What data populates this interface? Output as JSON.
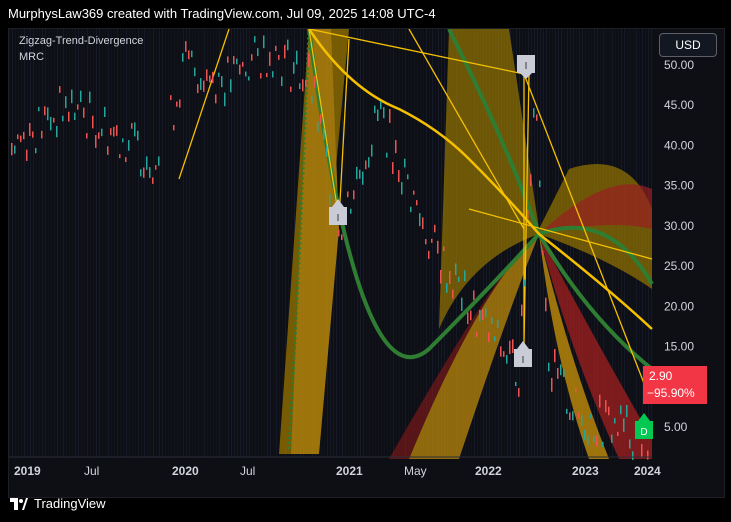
{
  "header": {
    "attribution": "MurphysLaw369 created with TradingView.com, Jul 09, 2025 14:08 UTC-4"
  },
  "indicators": [
    "Zigzag-Trend-Divergence",
    "MRC"
  ],
  "currency_button": "USD",
  "price_axis": {
    "labels": [
      "50.00",
      "45.00",
      "40.00",
      "35.00",
      "30.00",
      "25.00",
      "20.00",
      "15.00",
      "10.00",
      "5.00"
    ]
  },
  "time_axis": {
    "labels": [
      "2019",
      "Jul",
      "2020",
      "Jul",
      "2021",
      "May",
      "2022",
      "2023",
      "2024"
    ]
  },
  "markers": {
    "divergence_label": "I",
    "last_label": "D"
  },
  "last_price": {
    "price": "2.90",
    "change": "−95.90%"
  },
  "footer": {
    "brand": "TradingView"
  },
  "colors": {
    "up": "#26a69a",
    "down": "#ef5350",
    "zigzag": "#f5c000",
    "mrc_mean": "#2e7d32",
    "badge": "#f23645"
  },
  "chart_data": {
    "type": "line",
    "series": [],
    "ylim": [
      0,
      55
    ],
    "y_ticks": [
      50,
      45,
      40,
      35,
      30,
      25,
      20,
      15,
      10,
      5
    ],
    "x_ticks": [
      "2019",
      "Jul",
      "2020",
      "Jul",
      "2021",
      "May",
      "2022",
      "2023",
      "2024"
    ],
    "last_price": 2.9,
    "change_percent": -95.9
  }
}
